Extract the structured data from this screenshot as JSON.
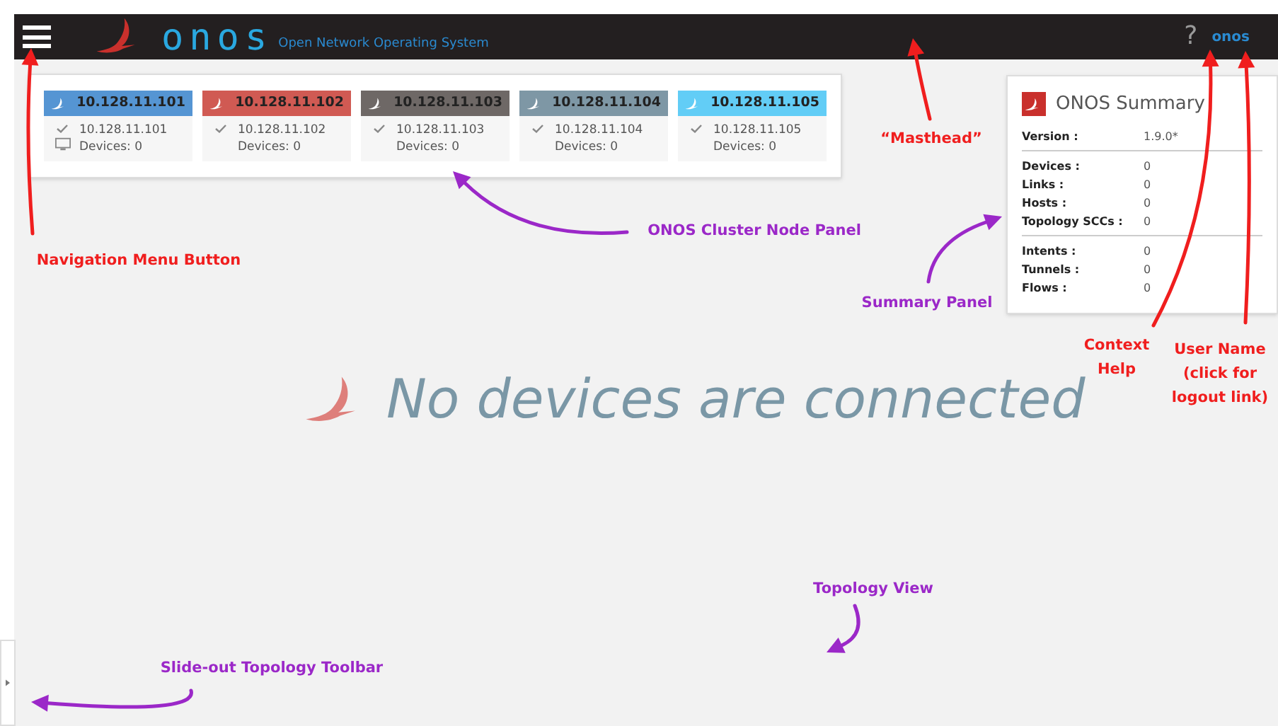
{
  "masthead": {
    "logo": "onos",
    "subtitle": "Open Network Operating System",
    "help": "?",
    "user": "onos"
  },
  "cluster_nodes": [
    {
      "title": "10.128.11.101",
      "color": "#5595d3",
      "ip": "10.128.11.101",
      "devices": "Devices: 0",
      "online": true,
      "connected": true
    },
    {
      "title": "10.128.11.102",
      "color": "#d05a53",
      "ip": "10.128.11.102",
      "devices": "Devices: 0",
      "online": true,
      "connected": false
    },
    {
      "title": "10.128.11.103",
      "color": "#6e6866",
      "ip": "10.128.11.103",
      "devices": "Devices: 0",
      "online": true,
      "connected": false
    },
    {
      "title": "10.128.11.104",
      "color": "#7e97a5",
      "ip": "10.128.11.104",
      "devices": "Devices: 0",
      "online": true,
      "connected": false
    },
    {
      "title": "10.128.11.105",
      "color": "#62cdf6",
      "ip": "10.128.11.105",
      "devices": "Devices: 0",
      "online": true,
      "connected": false
    }
  ],
  "summary": {
    "title": "ONOS Summary",
    "sections": [
      [
        {
          "label": "Version :",
          "value": "1.9.0*"
        }
      ],
      [
        {
          "label": "Devices :",
          "value": "0"
        },
        {
          "label": "Links :",
          "value": "0"
        },
        {
          "label": "Hosts :",
          "value": "0"
        },
        {
          "label": "Topology SCCs :",
          "value": "0"
        }
      ],
      [
        {
          "label": "Intents :",
          "value": "0"
        },
        {
          "label": "Tunnels :",
          "value": "0"
        },
        {
          "label": "Flows :",
          "value": "0"
        }
      ]
    ]
  },
  "topology": {
    "message": "No devices are connected"
  },
  "annotations": [
    {
      "text": "Navigation Menu Button",
      "color": "#f01e1e"
    },
    {
      "text": "“Masthead”",
      "color": "#f01e1e"
    },
    {
      "text": "ONOS Cluster Node Panel",
      "color": "#9b28c8"
    },
    {
      "text": "Summary Panel",
      "color": "#9b28c8"
    },
    {
      "text": "Context Help",
      "color": "#f01e1e"
    },
    {
      "text": "User Name (click for logout link)",
      "color": "#f01e1e"
    },
    {
      "text": "Topology View",
      "color": "#9b28c8"
    },
    {
      "text": "Slide-out Topology Toolbar",
      "color": "#9b28c8"
    }
  ]
}
